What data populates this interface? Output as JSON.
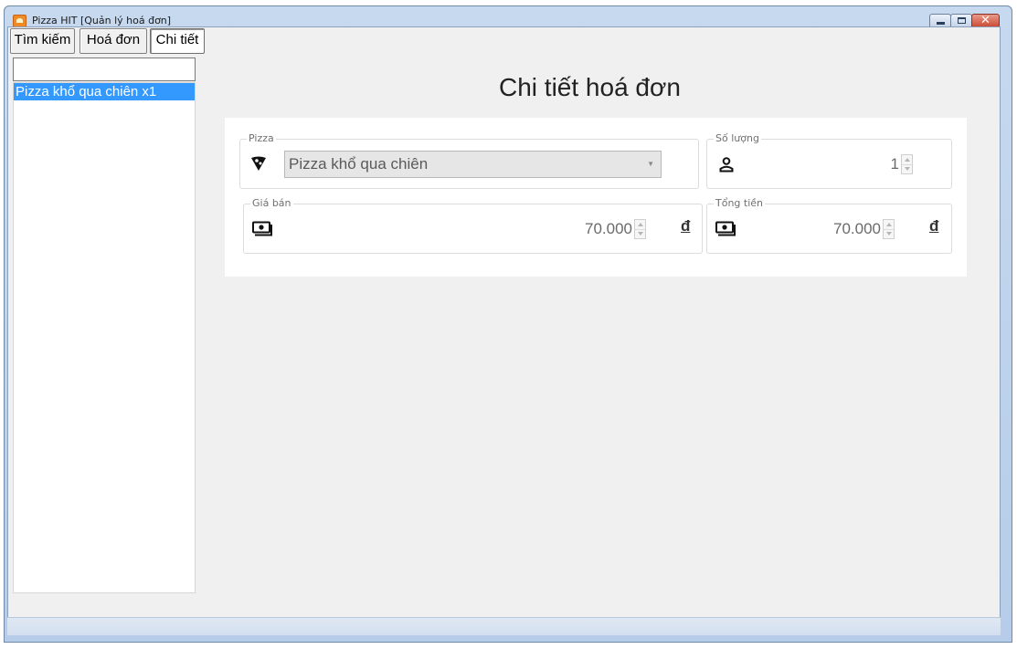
{
  "window": {
    "title": "Pizza HIT [Quản lý hoá đơn]"
  },
  "tabs": [
    {
      "label": "Tìm kiếm"
    },
    {
      "label": "Hoá đơn"
    },
    {
      "label": "Chi tiết",
      "active": true
    }
  ],
  "sidebar": {
    "search": {
      "value": ""
    },
    "items": [
      {
        "label": "Pizza khổ qua chiên x1",
        "selected": true
      }
    ]
  },
  "main": {
    "title": "Chi tiết hoá đơn",
    "pizza": {
      "legend": "Pizza",
      "value": "Pizza khổ qua chiên",
      "icon": "pizza-slice-icon"
    },
    "quantity": {
      "legend": "Số lượng",
      "value": "1",
      "icon": "person-icon"
    },
    "price": {
      "legend": "Giá bán",
      "value": "70.000",
      "currency": "đ",
      "icon": "money-icon"
    },
    "total": {
      "legend": "Tổng tiền",
      "value": "70.000",
      "currency": "đ",
      "icon": "money-icon"
    }
  },
  "colors": {
    "selection": "#3399ff",
    "client_bg": "#f0f0f0",
    "card_bg": "#ffffff"
  }
}
